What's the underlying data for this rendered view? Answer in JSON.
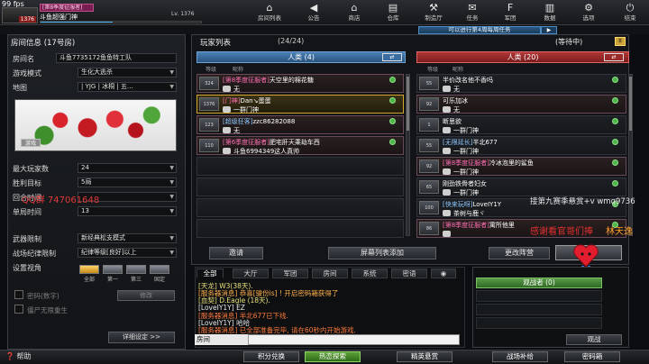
{
  "topbar": {
    "fps": "99 fps",
    "player_level_badge": "1376",
    "season_tag": "[第8季度征服者]",
    "player_name": "斗鱼超强门神",
    "level_text": "Lv. 1376",
    "nav": [
      {
        "label": "房间列表",
        "icon": "home-icon",
        "glyph": "⌂"
      },
      {
        "label": "公告",
        "icon": "megaphone-icon",
        "glyph": "📢"
      },
      {
        "label": "商店",
        "icon": "shop-icon",
        "glyph": "🏪"
      },
      {
        "label": "仓库",
        "icon": "warehouse-icon",
        "glyph": "▤"
      },
      {
        "label": "制造厅",
        "icon": "factory-icon",
        "glyph": "⚒"
      },
      {
        "label": "任务",
        "icon": "task-icon",
        "glyph": "✉"
      },
      {
        "label": "军团",
        "icon": "legion-icon",
        "glyph": "F"
      },
      {
        "label": "数据",
        "icon": "data-icon",
        "glyph": "▥"
      },
      {
        "label": "选项",
        "icon": "options-icon",
        "glyph": "⚙"
      },
      {
        "label": "结束",
        "icon": "power-icon",
        "glyph": "⏻"
      }
    ]
  },
  "weekly_task": "可以进行第4周每周任务",
  "room_info": {
    "title": "房间信息 (17号房)",
    "name_label": "房间名",
    "name_value": "斗鱼7735172鱼鱼特工队",
    "mode_label": "游戏模式",
    "mode_value": "生化大逃杀",
    "map_label": "地图",
    "map_value": "| YJG | 冰桐 | 五...",
    "map_tag": "游戏",
    "max_players_label": "最大玩家数",
    "max_players_value": "24",
    "win_target_label": "胜利目标",
    "win_target_value": "5局",
    "session_time_label": "回合时间",
    "session_time_value": "",
    "round_time_label": "单局时间",
    "round_time_value": "13",
    "weapon_limit_label": "武器限制",
    "weapon_limit_value": "新经典松支模式",
    "discipline_label": "战场纪律限制",
    "discipline_value": "纪律等级[良好]以上",
    "view_label": "设置视角",
    "view_options": [
      "全部",
      "第一",
      "第三",
      "固定"
    ],
    "password_label": "密码(数字)",
    "novice_label": "僵尸无限重生",
    "modify_button": "修改",
    "details_button": "详细设定 >>"
  },
  "overlay": {
    "qq_text": "QQ群 747061648",
    "sponsor_text": "接第九赛季悬赏+v wmq9736",
    "thanks_red": "感谢看官哥们捧",
    "thanks_orange": "林天逸"
  },
  "player_list": {
    "title": "玩家列表",
    "count": "(24/24)",
    "status": "(等待中)",
    "col_level": "等级",
    "col_name": "昵称",
    "blue_team": {
      "title": "人类 (4)",
      "players": [
        {
          "rank": "324",
          "tag": "[第8季度征服者]",
          "name": "天空里的棉花糖",
          "sub": "无",
          "style": "filled"
        },
        {
          "rank": "1376",
          "tag": "[门神]",
          "name": "Dan↘蛋蛋",
          "sub": "一群门神",
          "style": "hl"
        },
        {
          "rank": "123",
          "tag": "[超级狂客]",
          "name": "zzc86282088",
          "sub": "无",
          "style": "filled"
        },
        {
          "rank": "110",
          "tag": "[第6季度征服者]",
          "name": "肥宅肝天乘劫车西",
          "sub": "斗鱼6994349这人真帅",
          "style": "filled"
        },
        {
          "rank": "",
          "tag": "",
          "name": "",
          "sub": "",
          "style": ""
        },
        {
          "rank": "",
          "tag": "",
          "name": "",
          "sub": "",
          "style": ""
        },
        {
          "rank": "",
          "tag": "",
          "name": "",
          "sub": "",
          "style": ""
        },
        {
          "rank": "",
          "tag": "",
          "name": "",
          "sub": "",
          "style": ""
        }
      ]
    },
    "red_team": {
      "title": "人类 (20)",
      "players": [
        {
          "rank": "55",
          "tag": "",
          "name": "半价改名他不香吗",
          "sub": "无",
          "style": ""
        },
        {
          "rank": "92",
          "tag": "",
          "name": "可乐加冰",
          "sub": "无",
          "style": "filled"
        },
        {
          "rank": "1",
          "tag": "",
          "name": "断思欲",
          "sub": "一群门神",
          "style": ""
        },
        {
          "rank": "55",
          "tag": "[无限延长]",
          "name": "半北677",
          "sub": "一群门神",
          "style": ""
        },
        {
          "rank": "92",
          "tag": "[第8季度征服者]",
          "name": "冷冰泡里的鲨鱼",
          "sub": "一群门神",
          "style": "filled"
        },
        {
          "rank": "65",
          "tag": "",
          "name": "刚劲铁骨者妇女",
          "sub": "一群门神",
          "style": ""
        },
        {
          "rank": "100",
          "tag": "[快来玩呀]",
          "name": "LoveIY1Y",
          "sub": "茶树与鹿ヾ",
          "style": ""
        },
        {
          "rank": "86",
          "tag": "[第8季度征服者]",
          "name": "寓所他里",
          "sub": "",
          "style": "filled"
        }
      ]
    },
    "buttons": {
      "invite": "邀请",
      "add_room_list": "屏幕列表添加",
      "change_team": "更改阵营",
      "start": "开始"
    }
  },
  "chat": {
    "tabs": [
      "全部",
      "大厅",
      "军团",
      "房间",
      "系统",
      "密语"
    ],
    "lines": [
      {
        "text": "[天龙] W3(38天).",
        "color": "#e8e07a"
      },
      {
        "text": "[服务器消息] 恭喜[骏份is] ! 开启密码箱获得了",
        "color": "#ffb04a"
      },
      {
        "text": "[血契] D.Eagle (18天).",
        "color": "#e8e07a"
      },
      {
        "text": "[LoveIY1Y] EZ",
        "color": "#e8e8e8"
      },
      {
        "text": "[服务器消息] 半北677已下线.",
        "color": "#ff7a3a"
      },
      {
        "text": "[LoveIY1Y] 哈哈",
        "color": "#e8e8e8"
      },
      {
        "text": "[服务器消息] 已全部准备完毕, 请在60秒内开始游戏.",
        "color": "#ff7a3a"
      }
    ],
    "channel": "房间"
  },
  "spectators": {
    "title": "观战者 (0)",
    "button": "观战"
  },
  "bottom": {
    "help": "帮助",
    "buttons": [
      "积分兑换",
      "热恋探索",
      "精英悬赏",
      "战场补给",
      "密码箱"
    ]
  }
}
